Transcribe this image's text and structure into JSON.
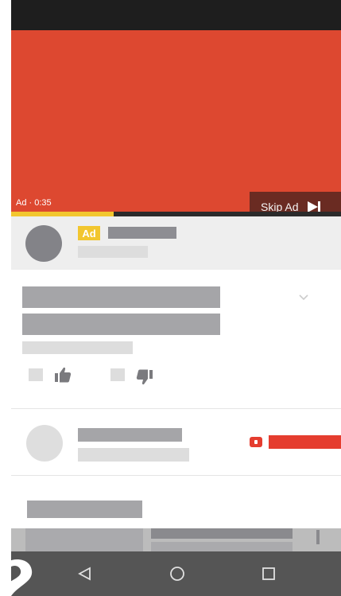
{
  "player": {
    "ad_time": "Ad · 0:35",
    "skip_label": "Skip Ad",
    "progress_fraction": 0.31
  },
  "ad_banner": {
    "badge": "Ad"
  },
  "colors": {
    "video_red": "#dd4830",
    "ad_yellow": "#f2c62f",
    "youtube_red": "#e53d2f",
    "navbar": "#555555"
  },
  "icons": {
    "skip": "skip-forward-icon",
    "like": "thumbs-up-icon",
    "dislike": "thumbs-down-icon",
    "chevron": "chevron-down-icon",
    "nav_back": "back-triangle-icon",
    "nav_home": "home-circle-icon",
    "nav_recents": "recents-square-icon"
  }
}
